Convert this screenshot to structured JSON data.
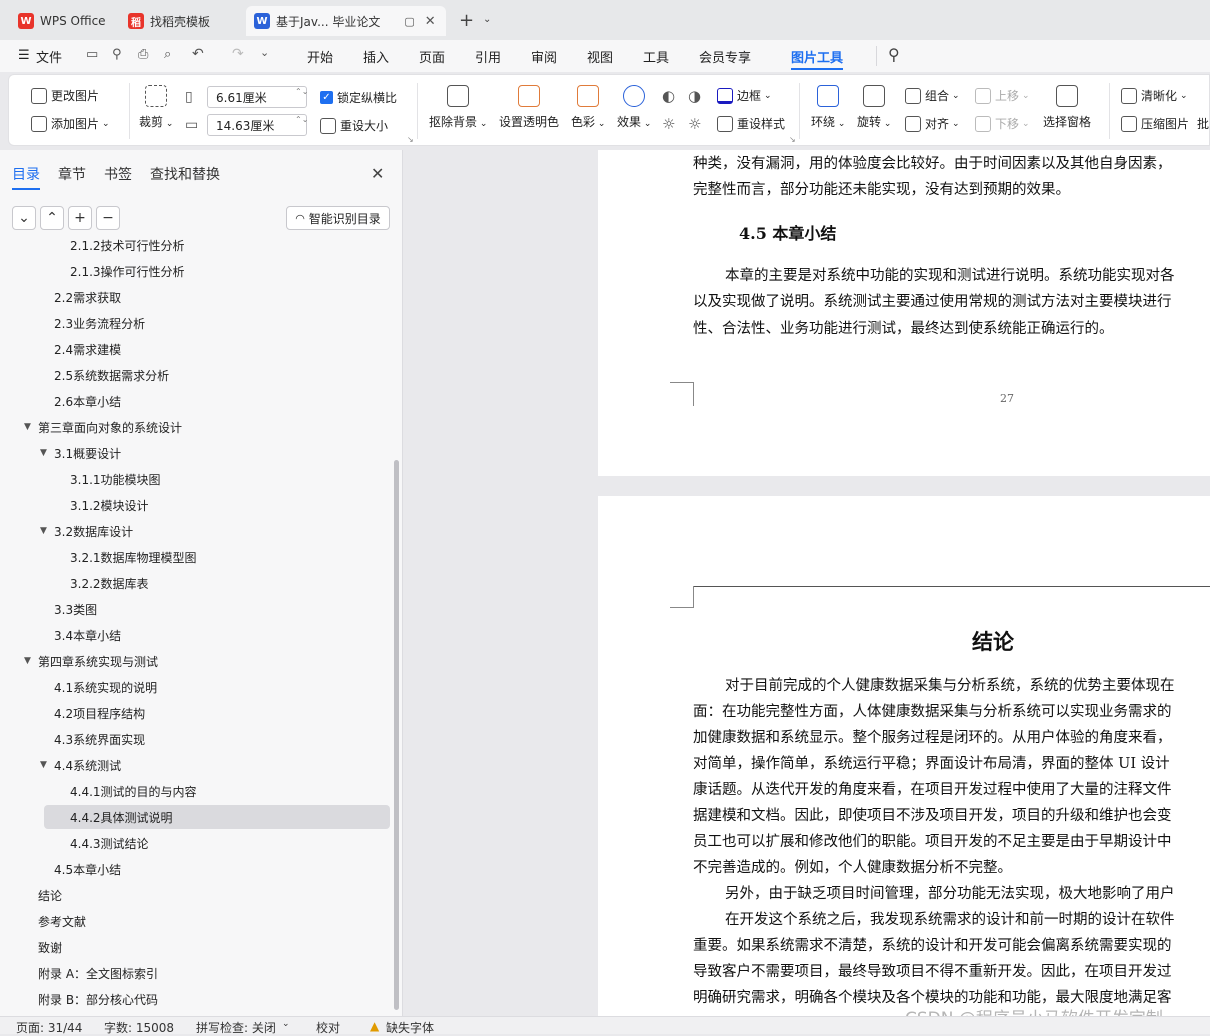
{
  "tabs": [
    {
      "label": "WPS Office",
      "logo": "W",
      "color": "#e8342b"
    },
    {
      "label": "找稻壳模板",
      "logo": "稻",
      "color": "#e8342b"
    },
    {
      "label": "基于Jav... 毕业论文",
      "logo": "W",
      "color": "#2b62d9"
    }
  ],
  "menu": {
    "file": "文件",
    "items": [
      "开始",
      "插入",
      "页面",
      "引用",
      "审阅",
      "视图",
      "工具",
      "会员专享",
      "图片工具"
    ]
  },
  "ribbon": {
    "change_picture": "更改图片",
    "add_picture": "添加图片",
    "crop": "裁剪",
    "width": "6.61厘米",
    "height": "14.63厘米",
    "lock_ratio": "锁定纵横比",
    "reset_size": "重设大小",
    "remove_bg": "抠除背景",
    "set_transparent": "设置透明色",
    "color": "色彩",
    "effect": "效果",
    "border": "边框",
    "reset_style": "重设样式",
    "wrap": "环绕",
    "rotate": "旋转",
    "group": "组合",
    "align": "对齐",
    "move_up": "上移",
    "move_down": "下移",
    "selection_pane": "选择窗格",
    "sharpen": "清晰化",
    "compress": "压缩图片",
    "more": "批"
  },
  "sidebar": {
    "tabs": [
      "目录",
      "章节",
      "书签",
      "查找和替换"
    ],
    "smart_toc": "智能识别目录",
    "toc": [
      {
        "label": "2.1.2技术可行性分析",
        "level": 3
      },
      {
        "label": "2.1.3操作可行性分析",
        "level": 3
      },
      {
        "label": "2.2需求获取",
        "level": 2
      },
      {
        "label": "2.3业务流程分析",
        "level": 2
      },
      {
        "label": "2.4需求建模",
        "level": 2
      },
      {
        "label": "2.5系统数据需求分析",
        "level": 2
      },
      {
        "label": "2.6本章小结",
        "level": 2
      },
      {
        "label": "第三章面向对象的系统设计",
        "level": 1,
        "expanded": true
      },
      {
        "label": "3.1概要设计",
        "level": 2,
        "expanded": true
      },
      {
        "label": "3.1.1功能模块图",
        "level": 3
      },
      {
        "label": "3.1.2模块设计",
        "level": 3
      },
      {
        "label": "3.2数据库设计",
        "level": 2,
        "expanded": true
      },
      {
        "label": "3.2.1数据库物理模型图",
        "level": 3
      },
      {
        "label": "3.2.2数据库表",
        "level": 3
      },
      {
        "label": "3.3类图",
        "level": 2
      },
      {
        "label": "3.4本章小结",
        "level": 2
      },
      {
        "label": "第四章系统实现与测试",
        "level": 1,
        "expanded": true
      },
      {
        "label": "4.1系统实现的说明",
        "level": 2
      },
      {
        "label": "4.2项目程序结构",
        "level": 2
      },
      {
        "label": "4.3系统界面实现",
        "level": 2
      },
      {
        "label": "4.4系统测试",
        "level": 2,
        "expanded": true
      },
      {
        "label": "4.4.1测试的目的与内容",
        "level": 3
      },
      {
        "label": "4.4.2具体测试说明",
        "level": 3,
        "selected": true
      },
      {
        "label": "4.4.3测试结论",
        "level": 3
      },
      {
        "label": "4.5本章小结",
        "level": 2
      },
      {
        "label": "结论",
        "level": 1
      },
      {
        "label": "参考文献",
        "level": 1
      },
      {
        "label": "致谢",
        "level": 1
      },
      {
        "label": "附录 A：全文图标索引",
        "level": 1
      },
      {
        "label": "附录 B：部分核心代码",
        "level": 1
      }
    ]
  },
  "doc": {
    "page1_lines": [
      "种类，没有漏洞，用的体验度会比较好。由于时间因素以及其他自身因素，",
      "完整性而言，部分功能还未能实现，没有达到预期的效果。"
    ],
    "section_title": "4.5  本章小结",
    "summary_lines": [
      "本章的主要是对系统中功能的实现和测试进行说明。系统功能实现对各",
      "以及实现做了说明。系统测试主要通过使用常规的测试方法对主要模块进行",
      "性、合法性、业务功能进行测试，最终达到使系统能正确运行的。"
    ],
    "page_number": "27",
    "conclusion_title": "结论",
    "conclusion_lines": [
      "对于目前完成的个人健康数据采集与分析系统，系统的优势主要体现在",
      "面：在功能完整性方面，人体健康数据采集与分析系统可以实现业务需求的",
      "加健康数据和系统显示。整个服务过程是闭环的。从用户体验的角度来看，",
      "对简单，操作简单，系统运行平稳；界面设计布局清，界面的整体 UI 设计",
      "康话题。从迭代开发的角度来看，在项目开发过程中使用了大量的注释文件",
      "据建模和文档。因此，即使项目不涉及项目开发，项目的升级和维护也会变",
      "员工也可以扩展和修改他们的职能。项目开发的不足主要是由于早期设计中",
      "不完善造成的。例如，个人健康数据分析不完整。",
      "另外，由于缺乏项目时间管理，部分功能无法实现，极大地影响了用户",
      "在开发这个系统之后，我发现系统需求的设计和前一时期的设计在软件",
      "重要。如果系统需求不清楚，系统的设计和开发可能会偏离系统需要实现的",
      "导致客户不需要项目，最终导致项目不得不重新开发。因此，在项目开发过",
      "明确研究需求，明确各个模块及各个模块的功能和功能，最大限度地满足客"
    ]
  },
  "status": {
    "page": "页面: 31/44",
    "words": "字数: 15008",
    "spell": "拼写检查: 关闭",
    "proof": "校对",
    "missing_font": "缺失字体"
  },
  "watermark": "CSDN @程序员小马软件开发定制",
  "accent": "#1e6ff0"
}
